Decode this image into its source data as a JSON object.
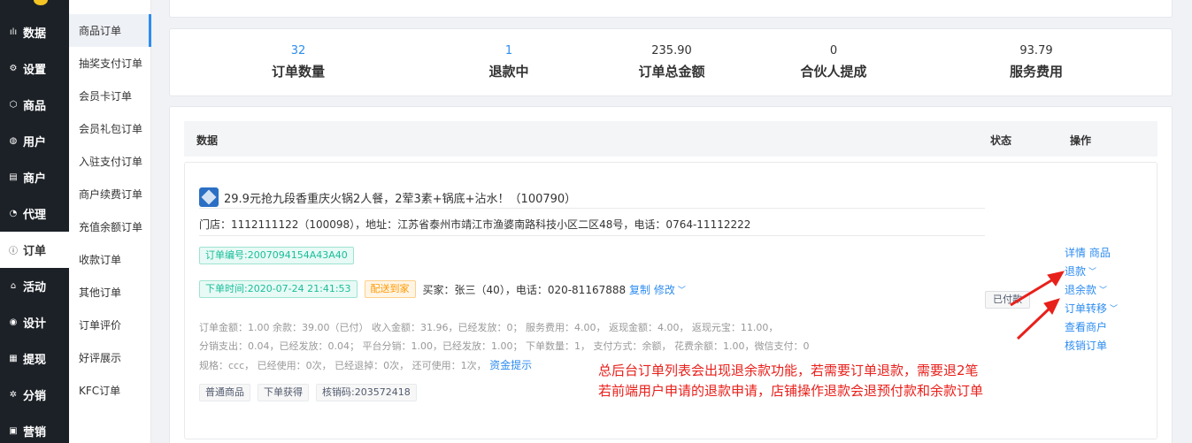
{
  "sidebar": {
    "items": [
      {
        "icon": "bar-chart-icon",
        "glyph": "ılı",
        "label": "数据"
      },
      {
        "icon": "gear-icon",
        "glyph": "⚙",
        "label": "设置"
      },
      {
        "icon": "cube-icon",
        "glyph": "⬡",
        "label": "商品"
      },
      {
        "icon": "user-icon",
        "glyph": "◍",
        "label": "用户"
      },
      {
        "icon": "store-icon",
        "glyph": "▤",
        "label": "商户"
      },
      {
        "icon": "agent-icon",
        "glyph": "◔",
        "label": "代理"
      },
      {
        "icon": "order-icon",
        "glyph": "ⓘ",
        "label": "订单"
      },
      {
        "icon": "tag-icon",
        "glyph": "⌂",
        "label": "活动"
      },
      {
        "icon": "palette-icon",
        "glyph": "◉",
        "label": "设计"
      },
      {
        "icon": "withdraw-icon",
        "glyph": "▦",
        "label": "提现"
      },
      {
        "icon": "share-icon",
        "glyph": "✲",
        "label": "分销"
      },
      {
        "icon": "marketing-icon",
        "glyph": "▣",
        "label": "营销"
      }
    ]
  },
  "submenu": {
    "items": [
      "商品订单",
      "抽奖支付订单",
      "会员卡订单",
      "会员礼包订单",
      "入驻支付订单",
      "商户续费订单",
      "充值余额订单",
      "收款订单",
      "其他订单",
      "订单评价",
      "好评展示",
      "KFC订单"
    ]
  },
  "stats": [
    {
      "value": "32",
      "label": "订单数量"
    },
    {
      "value": "1",
      "label": "退款中"
    },
    {
      "value": "235.90",
      "label": "订单总金额"
    },
    {
      "value": "0",
      "label": "合伙人提成"
    },
    {
      "value": "93.79",
      "label": "服务费用"
    }
  ],
  "table": {
    "col_data": "数据",
    "col_status": "状态",
    "col_action": "操作"
  },
  "order": {
    "title": "29.9元抢九段香重庆火锅2人餐，2荤3素+锅底+沾水！（100790）",
    "shop": "门店：1112111122（100098），地址：江苏省泰州市靖江市渔婆南路科技小区二区48号，电话：0764-11112222",
    "order_no": "订单编号:2007094154A43A40",
    "order_time": "下单时间:2020-07-24 21:41:53",
    "delivery": "配送到家",
    "buyer": "买家：张三（40），电话：020-81167888",
    "copy": "复制",
    "edit": "修改",
    "detail1": "订单金额：1.00    余款：39.00（已付）   收入金额：31.96，已经发放：0；    服务费用：4.00，    返现金额：4.00，     返现元宝：11.00，",
    "detail2": "分销支出：0.04，已经发放：0.04；     平台分销：1.00，已经发放：1.00；     下单数量：1，     支付方式：余额，     花费余额：1.00，微信支付：0",
    "detail3": "规格：ccc，     已经使用：0次，     已经退掉：0次，     还可使用：1次，",
    "fund_link": "资金提示",
    "tags": [
      "普通商品",
      "下单获得",
      "核销码:203572418"
    ],
    "status": "已付款",
    "ops": [
      {
        "label": "详情 商品",
        "caret": false
      },
      {
        "label": "退款",
        "caret": true
      },
      {
        "label": "退余款",
        "caret": true
      },
      {
        "label": "订单转移",
        "caret": true
      },
      {
        "label": "查看商户",
        "caret": false
      },
      {
        "label": "核销订单",
        "caret": false
      }
    ]
  },
  "annotation": {
    "line1": "总后台订单列表会出现退余款功能，若需要订单退款，需要退2笔",
    "line2": "若前端用户申请的退款申请，店铺操作退款会退预付款和余款订单",
    "color": "#e8201b"
  }
}
